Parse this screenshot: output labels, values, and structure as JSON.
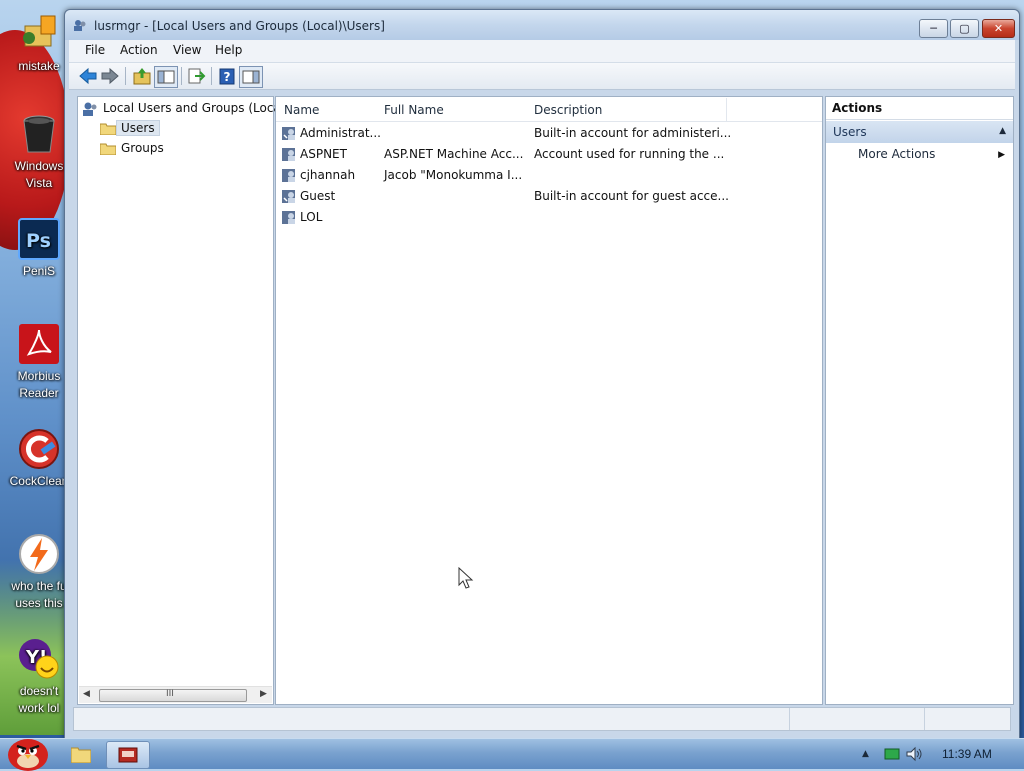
{
  "desktop": {
    "icons": [
      {
        "label_lines": [
          "mistake"
        ],
        "icon": "folder-sync-icon"
      },
      {
        "label_lines": [
          "Windows",
          "Vista"
        ],
        "icon": "recycle-bin-icon"
      },
      {
        "label_lines": [
          "PeniS"
        ],
        "icon": "photoshop-icon"
      },
      {
        "label_lines": [
          "Morbius",
          "Reader"
        ],
        "icon": "pdf-reader-icon"
      },
      {
        "label_lines": [
          "CockClean"
        ],
        "icon": "ccleaner-icon"
      },
      {
        "label_lines": [
          "who the fu",
          "uses this"
        ],
        "icon": "lightning-app-icon"
      },
      {
        "label_lines": [
          "doesn't",
          "work lol"
        ],
        "icon": "yahoo-messenger-icon"
      }
    ]
  },
  "window": {
    "title": "lusrmgr - [Local Users and Groups (Local)\\Users]",
    "min_glyph": "─",
    "max_glyph": "▢",
    "close_glyph": "✕"
  },
  "menu": [
    "File",
    "Action",
    "View",
    "Help"
  ],
  "toolbar": [
    "back-icon",
    "forward-icon",
    "up-folder-icon",
    "show-hide-tree-icon",
    "export-list-icon",
    "help-icon",
    "action-pane-icon"
  ],
  "tree": {
    "root": "Local Users and Groups (Loca",
    "children": [
      "Users",
      "Groups"
    ],
    "selected": "Users",
    "scroll_grip": "III",
    "scroll_left": "◀",
    "scroll_right": "▶"
  },
  "list": {
    "columns": [
      "Name",
      "Full Name",
      "Description"
    ],
    "rows": [
      {
        "name": "Administrat...",
        "full_name": "",
        "description": "Built-in account for administeri..."
      },
      {
        "name": "ASPNET",
        "full_name": "ASP.NET Machine Acc...",
        "description": "Account used for running the ..."
      },
      {
        "name": "cjhannah",
        "full_name": "Jacob \"Monokumma I...",
        "description": ""
      },
      {
        "name": "Guest",
        "full_name": "",
        "description": "Built-in account for guest acce..."
      },
      {
        "name": "LOL",
        "full_name": "",
        "description": ""
      }
    ]
  },
  "actions": {
    "title": "Actions",
    "section": "Users",
    "collapse_glyph": "▲",
    "item": "More Actions",
    "item_arrow": "▶"
  },
  "taskbar": {
    "clock": "11:39 AM"
  }
}
